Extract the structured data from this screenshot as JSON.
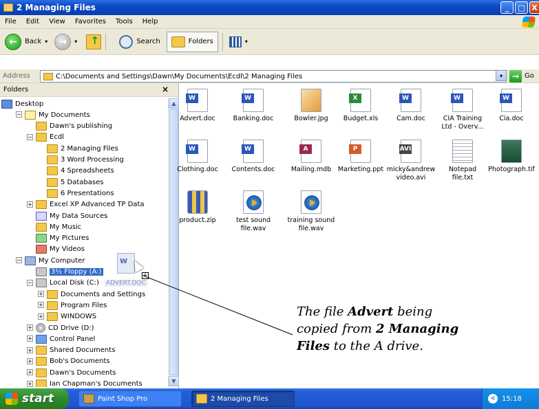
{
  "window": {
    "title": "2 Managing Files",
    "minimize": "_",
    "maximize": "□",
    "close": "X"
  },
  "menubar": [
    "File",
    "Edit",
    "View",
    "Favorites",
    "Tools",
    "Help"
  ],
  "toolbar": {
    "back_label": "Back",
    "search_label": "Search",
    "folders_label": "Folders",
    "dropdown_glyph": "▾"
  },
  "address": {
    "label": "Address",
    "value": "C:\\Documents and Settings\\Dawn\\My Documents\\Ecdl\\2 Managing Files",
    "go_label": "Go"
  },
  "folders_pane": {
    "header": "Folders",
    "close": "×",
    "tree": [
      {
        "label": "Desktop",
        "icon": "desktop-icon",
        "level": 0,
        "expander": ""
      },
      {
        "label": "My Documents",
        "icon": "my-documents-icon",
        "level": 1,
        "expander": "−"
      },
      {
        "label": "Dawn's publishing",
        "icon": "folder-icon",
        "level": 2,
        "expander": ""
      },
      {
        "label": "Ecdl",
        "icon": "folder-icon",
        "level": 2,
        "expander": "−"
      },
      {
        "label": "2 Managing Files",
        "icon": "folder-icon",
        "level": 3,
        "expander": ""
      },
      {
        "label": "3 Word Processing",
        "icon": "folder-icon",
        "level": 3,
        "expander": ""
      },
      {
        "label": "4 Spreadsheets",
        "icon": "folder-icon",
        "level": 3,
        "expander": ""
      },
      {
        "label": "5 Databases",
        "icon": "folder-icon",
        "level": 3,
        "expander": ""
      },
      {
        "label": "6 Presentations",
        "icon": "folder-icon",
        "level": 3,
        "expander": ""
      },
      {
        "label": "Excel XP Advanced TP Data",
        "icon": "folder-icon",
        "level": 2,
        "expander": "+"
      },
      {
        "label": "My Data Sources",
        "icon": "data-sources-icon",
        "level": 2,
        "expander": ""
      },
      {
        "label": "My Music",
        "icon": "music-folder-icon",
        "level": 2,
        "expander": ""
      },
      {
        "label": "My Pictures",
        "icon": "pictures-folder-icon",
        "level": 2,
        "expander": ""
      },
      {
        "label": "My Videos",
        "icon": "videos-folder-icon",
        "level": 2,
        "expander": ""
      },
      {
        "label": "My Computer",
        "icon": "my-computer-icon",
        "level": 1,
        "expander": "−"
      },
      {
        "label": "3½ Floppy (A:)",
        "icon": "floppy-drive-icon",
        "level": 2,
        "expander": "",
        "selected": true
      },
      {
        "label": "Local Disk (C:)",
        "icon": "hard-disk-icon",
        "level": 2,
        "expander": "−"
      },
      {
        "label": "Documents and Settings",
        "icon": "folder-icon",
        "level": 3,
        "expander": "+"
      },
      {
        "label": "Program Files",
        "icon": "folder-icon",
        "level": 3,
        "expander": "+"
      },
      {
        "label": "WINDOWS",
        "icon": "folder-icon",
        "level": 3,
        "expander": "+"
      },
      {
        "label": "CD Drive (D:)",
        "icon": "cd-drive-icon",
        "level": 2,
        "expander": "+"
      },
      {
        "label": "Control Panel",
        "icon": "control-panel-icon",
        "level": 2,
        "expander": "+"
      },
      {
        "label": "Shared Documents",
        "icon": "folder-icon",
        "level": 2,
        "expander": "+"
      },
      {
        "label": "Bob's Documents",
        "icon": "folder-icon",
        "level": 2,
        "expander": "+"
      },
      {
        "label": "Dawn's Documents",
        "icon": "folder-icon",
        "level": 2,
        "expander": "+"
      },
      {
        "label": "Ian Chapman's Documents",
        "icon": "folder-icon",
        "level": 2,
        "expander": "+"
      }
    ],
    "drag_label": "ADVERT.DOC",
    "drag_plus": "+"
  },
  "files": [
    {
      "name": "Advert.doc",
      "kind": "doc",
      "tag": "W"
    },
    {
      "name": "Banking.doc",
      "kind": "doc",
      "tag": "W"
    },
    {
      "name": "Bowler.jpg",
      "kind": "jpg",
      "tag": ""
    },
    {
      "name": "Budget.xls",
      "kind": "xls",
      "tag": "X"
    },
    {
      "name": "Cam.doc",
      "kind": "doc",
      "tag": "W"
    },
    {
      "name": "CIA Training\nLtd - Overv...",
      "kind": "doc",
      "tag": "W"
    },
    {
      "name": "Cia.doc",
      "kind": "doc",
      "tag": "W"
    },
    {
      "name": "Clothing.doc",
      "kind": "doc",
      "tag": "W"
    },
    {
      "name": "Contents.doc",
      "kind": "doc",
      "tag": "W"
    },
    {
      "name": "Mailing.mdb",
      "kind": "mdb",
      "tag": "A"
    },
    {
      "name": "Marketing.ppt",
      "kind": "ppt",
      "tag": "P"
    },
    {
      "name": "micky&andrew\nvideo.avi",
      "kind": "avi",
      "tag": "AVI"
    },
    {
      "name": "Notepad\nfile.txt",
      "kind": "txt",
      "tag": ""
    },
    {
      "name": "Photograph.tif",
      "kind": "tif",
      "tag": ""
    },
    {
      "name": "product.zip",
      "kind": "zip",
      "tag": ""
    },
    {
      "name": "test sound\nfile.wav",
      "kind": "wav",
      "tag": ""
    },
    {
      "name": "training sound\nfile.wav",
      "kind": "wav",
      "tag": ""
    }
  ],
  "annotation": {
    "line1_a": "The file ",
    "line1_b": "Advert",
    "line1_c": " being",
    "line2_a": "copied from ",
    "line2_b": "2 Managing",
    "line3_a": "Files",
    "line3_b": " to the A drive."
  },
  "taskbar": {
    "start_label": "start",
    "tasks": [
      "Paint Shop Pro",
      "2 Managing Files"
    ],
    "clock": "15:18"
  }
}
